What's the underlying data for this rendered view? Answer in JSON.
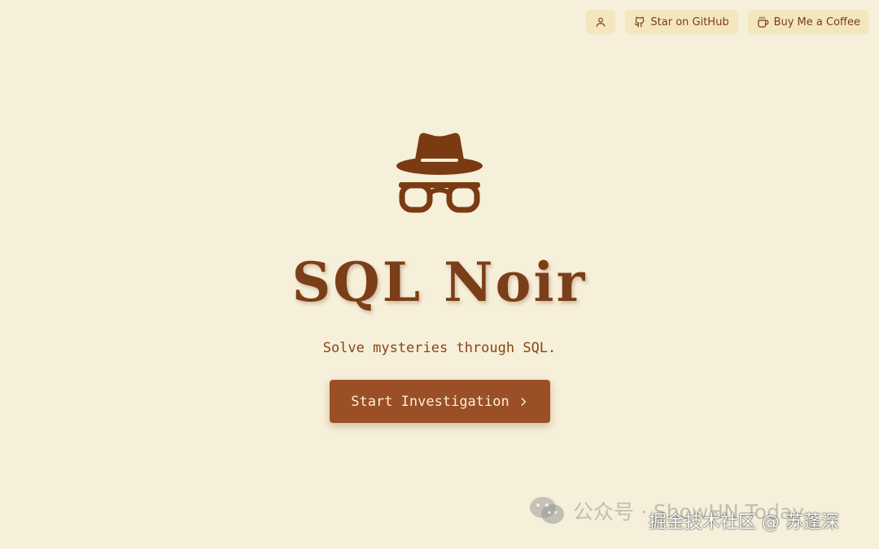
{
  "header": {
    "user_icon": "user-icon",
    "github_label": "Star on GitHub",
    "github_icon": "github-icon",
    "coffee_label": "Buy Me a Coffee",
    "coffee_icon": "coffee-cup-icon"
  },
  "hero": {
    "logo_icon": "detective-hat-glasses-icon",
    "title": "SQL Noir",
    "subtitle": "Solve mysteries through SQL.",
    "cta_label": "Start Investigation",
    "cta_icon": "chevron-right-icon"
  },
  "watermark": {
    "icon": "wechat-icon",
    "text": "公众号 · ShowHN Today",
    "secondary_text": "掘金技术社区 @ 苏蓬深"
  },
  "colors": {
    "background": "#f6efd9",
    "top_button_bg": "#f4e6bf",
    "brand_brown": "#7a3e18",
    "cta_bg": "#9a4f26",
    "cta_text": "#fbeed7"
  }
}
